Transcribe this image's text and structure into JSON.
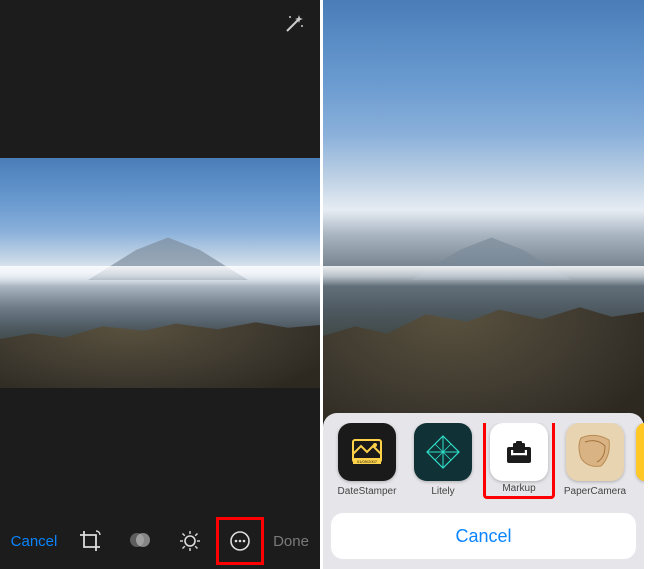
{
  "left": {
    "cancel": "Cancel",
    "done": "Done"
  },
  "right": {
    "sheet": {
      "apps": [
        {
          "label": "DateStamper"
        },
        {
          "label": "Litely"
        },
        {
          "label": "Markup"
        },
        {
          "label": "PaperCamera"
        }
      ],
      "cancel": "Cancel"
    }
  },
  "colors": {
    "accentBlue": "#0a84ff",
    "highlightRed": "#ff0000"
  }
}
